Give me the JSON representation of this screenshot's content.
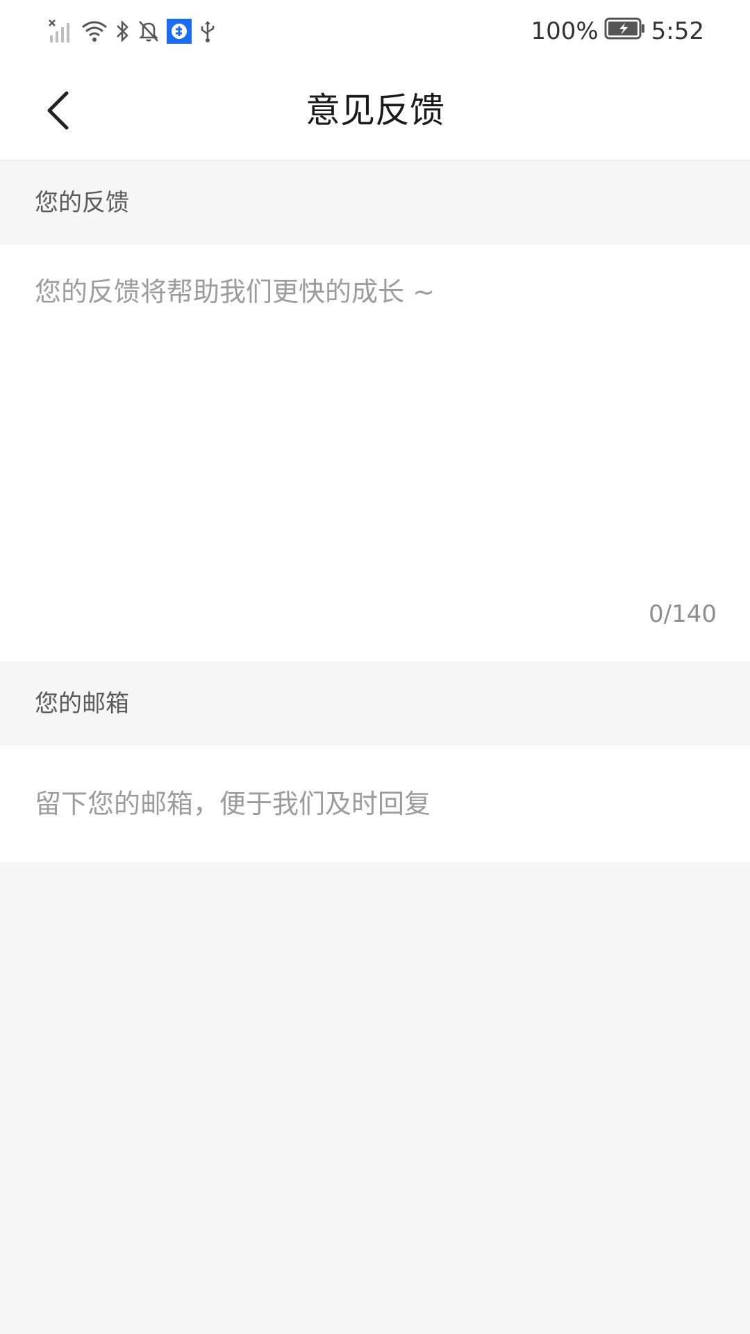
{
  "status_bar": {
    "battery_percent": "100%",
    "time": "5:52",
    "icons": [
      "signal-off-icon",
      "wifi-icon",
      "bluetooth-icon",
      "bell-muted-icon",
      "app-notification-icon",
      "usb-icon",
      "battery-charging-icon"
    ],
    "app_icon_color": "#1a6cf5"
  },
  "header": {
    "title": "意见反馈",
    "back_icon": "chevron-left-icon"
  },
  "feedback_section": {
    "label": "您的反馈",
    "placeholder": "您的反馈将帮助我们更快的成长 ~",
    "value": "",
    "counter": "0/140"
  },
  "email_section": {
    "label": "您的邮箱",
    "placeholder": "留下您的邮箱，便于我们及时回复",
    "value": ""
  },
  "colors": {
    "page_background": "#f7f7f7",
    "card_background": "#ffffff",
    "placeholder_text": "#9c9c9c",
    "title_text": "#1a1a1a"
  }
}
